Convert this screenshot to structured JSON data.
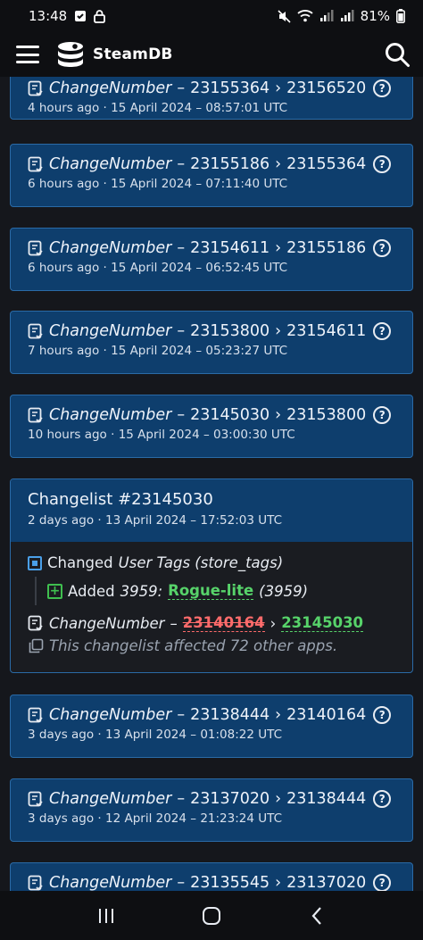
{
  "status_bar": {
    "time": "13:48",
    "battery": "81%"
  },
  "app": {
    "title": "SteamDB"
  },
  "colors": {
    "card_bg": "#0e3e6d",
    "card_border": "#2a6aa6",
    "added": "#57d36a",
    "removed": "#ff6b6b",
    "bg": "#15171c"
  },
  "cards": [
    {
      "label": "ChangeNumber",
      "sep": "–",
      "from": "23155364",
      "arrow": "›",
      "to": "23156520",
      "time": "4 hours ago · 15 April 2024 – 08:57:01 UTC"
    },
    {
      "label": "ChangeNumber",
      "sep": "–",
      "from": "23155186",
      "arrow": "›",
      "to": "23155364",
      "time": "6 hours ago · 15 April 2024 – 07:11:40 UTC"
    },
    {
      "label": "ChangeNumber",
      "sep": "–",
      "from": "23154611",
      "arrow": "›",
      "to": "23155186",
      "time": "6 hours ago · 15 April 2024 – 06:52:45 UTC"
    },
    {
      "label": "ChangeNumber",
      "sep": "–",
      "from": "23153800",
      "arrow": "›",
      "to": "23154611",
      "time": "7 hours ago · 15 April 2024 – 05:23:27 UTC"
    },
    {
      "label": "ChangeNumber",
      "sep": "–",
      "from": "23145030",
      "arrow": "›",
      "to": "23153800",
      "time": "10 hours ago · 15 April 2024 – 03:00:30 UTC"
    }
  ],
  "changelist": {
    "title": "Changelist #23145030",
    "time": "2 days ago · 13 April 2024 – 17:52:03 UTC",
    "changed_prefix": "Changed",
    "changed_field": "User Tags (store_tags)",
    "added_prefix": "Added",
    "tag_id": "3959:",
    "tag_name": "Rogue-lite",
    "tag_paren": "(3959)",
    "cn_label": "ChangeNumber",
    "cn_sep": "–",
    "cn_old": "23140164",
    "cn_arrow": "›",
    "cn_new": "23145030",
    "affected": "This changelist affected 72 other apps."
  },
  "cards_after": [
    {
      "label": "ChangeNumber",
      "sep": "–",
      "from": "23138444",
      "arrow": "›",
      "to": "23140164",
      "time": "3 days ago · 13 April 2024 – 01:08:22 UTC"
    },
    {
      "label": "ChangeNumber",
      "sep": "–",
      "from": "23137020",
      "arrow": "›",
      "to": "23138444",
      "time": "3 days ago · 12 April 2024 – 21:23:24 UTC"
    },
    {
      "label": "ChangeNumber",
      "sep": "–",
      "from": "23135545",
      "arrow": "›",
      "to": "23137020",
      "time": ""
    }
  ],
  "icons": {
    "menu": "hamburger-icon",
    "search": "search-icon",
    "doc": "document-icon",
    "help": "help-circle-icon",
    "copy": "copy-icon",
    "nav_recent": "recent-apps-icon",
    "nav_home": "home-icon",
    "nav_back": "back-icon"
  },
  "help_glyph": "?"
}
